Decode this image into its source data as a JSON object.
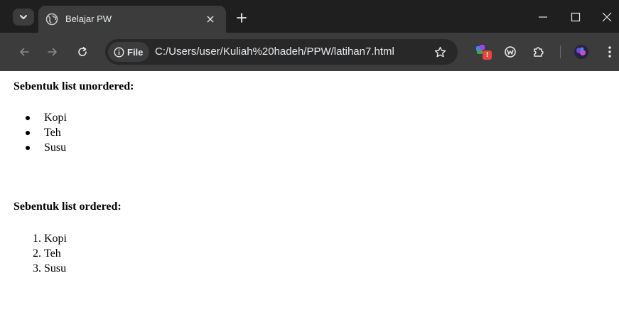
{
  "browser": {
    "tab_title": "Belajar PW",
    "tab_close": "×",
    "address_chip_label": "File",
    "url": "C:/Users/user/Kuliah%20hadeh/PPW/latihan7.html",
    "extension_badge": "!",
    "colors": {
      "tabstrip": "#1f1f1f",
      "toolbar": "#3c3c3c",
      "badge": "#e8453c"
    }
  },
  "page": {
    "unordered_heading": "Sebentuk list unordered:",
    "unordered_items": [
      "Kopi",
      "Teh",
      "Susu"
    ],
    "ordered_heading": "Sebentuk list ordered:",
    "ordered_items": [
      {
        "marker": "1.",
        "label": "Kopi"
      },
      {
        "marker": "2.",
        "label": "Teh"
      },
      {
        "marker": "3.",
        "label": "Susu"
      }
    ]
  }
}
